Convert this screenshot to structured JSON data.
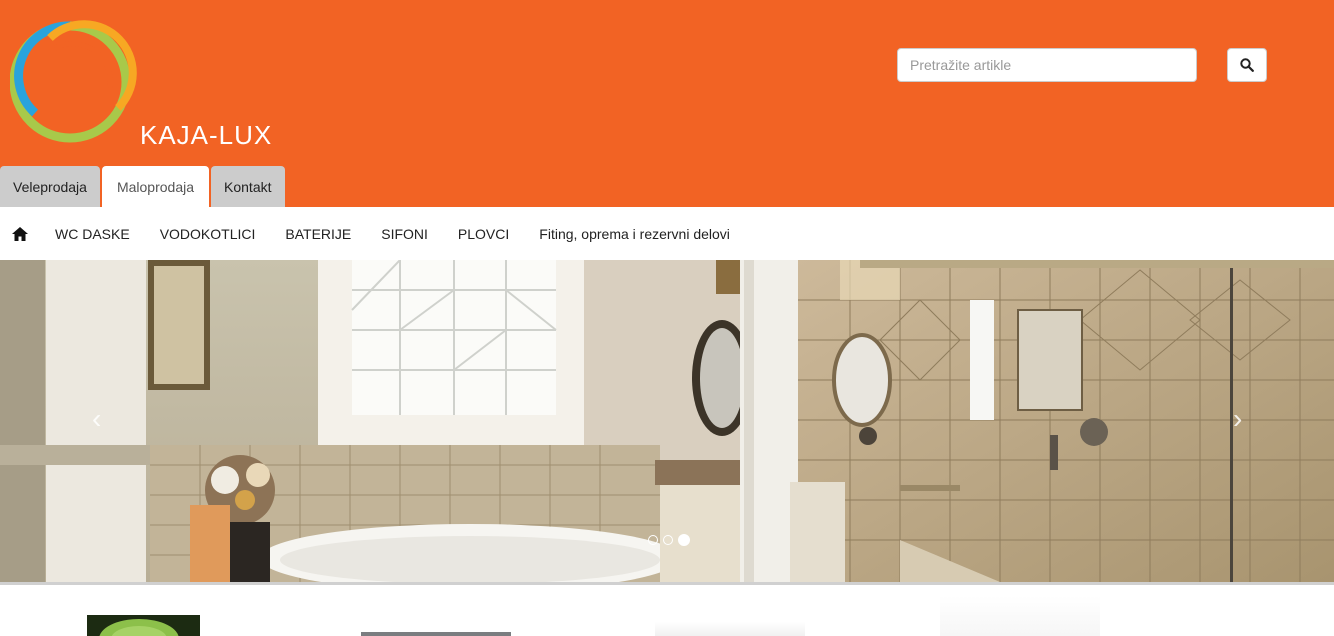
{
  "brand": {
    "name": "KAJA-LUX",
    "logo_icon": "rings-logo-icon"
  },
  "colors": {
    "header": "#f26324",
    "tab_inactive": "#cccccc",
    "tab_active": "#ffffff"
  },
  "search": {
    "placeholder": "Pretražite artikle",
    "value": "",
    "button_icon": "search-icon"
  },
  "tabs": [
    {
      "label": "Veleprodaja",
      "active": false
    },
    {
      "label": "Maloprodaja",
      "active": true
    },
    {
      "label": "Kontakt",
      "active": false
    }
  ],
  "nav": {
    "home_icon": "home-icon",
    "items": [
      {
        "label": "WC DASKE"
      },
      {
        "label": "VODOKOTLICI"
      },
      {
        "label": "BATERIJE"
      },
      {
        "label": "SIFONI"
      },
      {
        "label": "PLOVCI"
      },
      {
        "label": "Fiting, oprema i rezervni delovi"
      }
    ]
  },
  "carousel": {
    "prev_icon": "chevron-left-icon",
    "next_icon": "chevron-right-icon",
    "prev_glyph": "‹",
    "next_glyph": "›",
    "slide_count": 3,
    "active_slide": 3
  }
}
